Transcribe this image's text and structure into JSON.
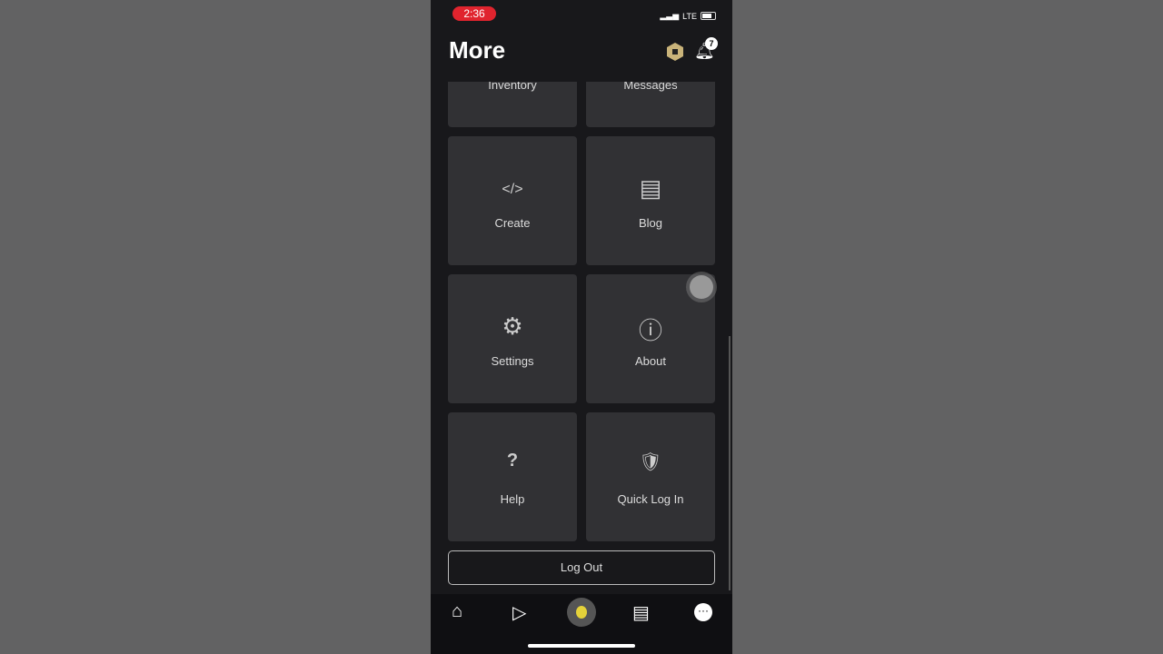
{
  "status": {
    "time": "2:36",
    "network": "LTE"
  },
  "header": {
    "title": "More",
    "notification_count": "7"
  },
  "tiles": [
    {
      "label": "Inventory",
      "icon": "inventory-icon"
    },
    {
      "label": "Messages",
      "icon": "messages-icon"
    },
    {
      "label": "Create",
      "icon": "code-external-icon",
      "glyph": "</>"
    },
    {
      "label": "Blog",
      "icon": "blog-icon",
      "glyph": "▤"
    },
    {
      "label": "Settings",
      "icon": "gear-icon",
      "glyph": "⚙"
    },
    {
      "label": "About",
      "icon": "info-icon",
      "glyph": "ⓘ"
    },
    {
      "label": "Help",
      "icon": "help-external-icon",
      "glyph": "?"
    },
    {
      "label": "Quick Log In",
      "icon": "shield-lock-icon",
      "glyph": "🛡"
    }
  ],
  "logout_label": "Log Out",
  "nav": {
    "home": "⌂",
    "discover": "▷",
    "chat": "▤",
    "more": "···"
  }
}
